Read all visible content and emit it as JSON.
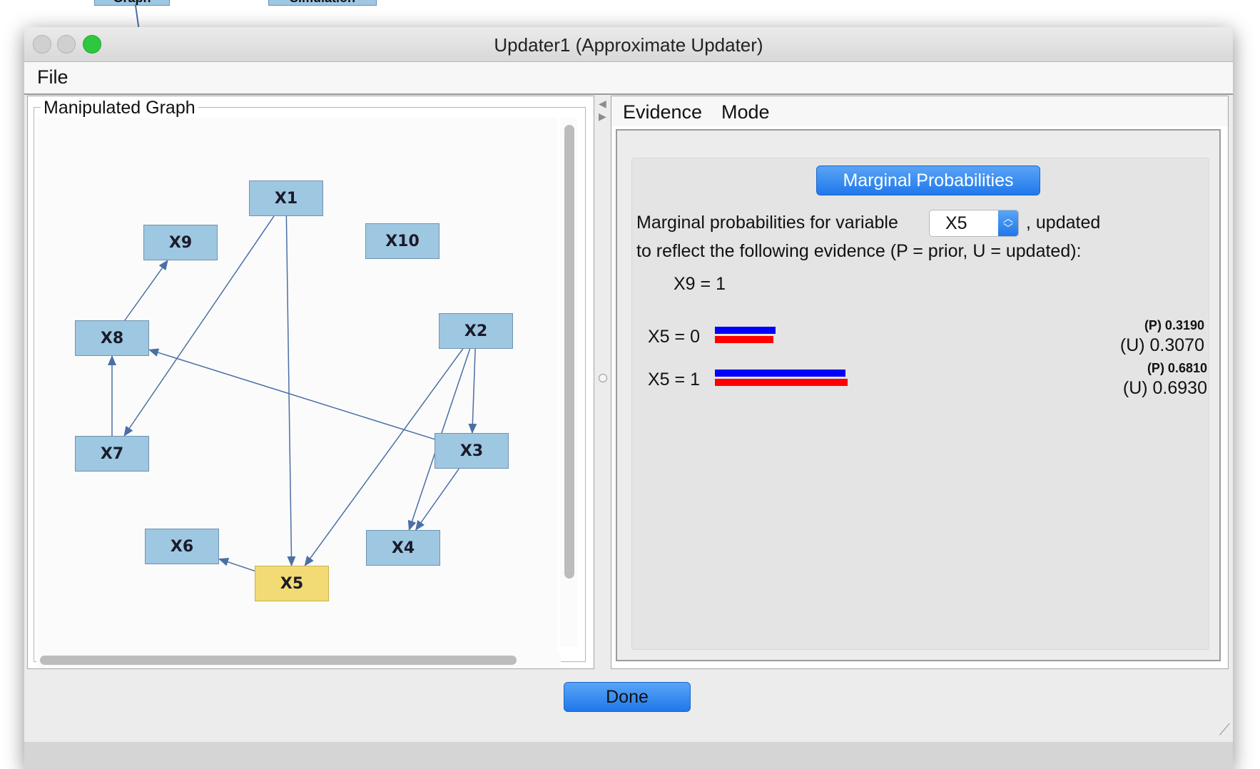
{
  "background": {
    "nodes": [
      "Graph",
      "Simulation"
    ]
  },
  "window": {
    "title": "Updater1 (Approximate Updater)",
    "menu": [
      "File"
    ]
  },
  "left_panel": {
    "title": "Manipulated Graph",
    "nodes": [
      {
        "id": "X1",
        "label": "X1",
        "selected": false
      },
      {
        "id": "X9",
        "label": "X9",
        "selected": false
      },
      {
        "id": "X10",
        "label": "X10",
        "selected": false
      },
      {
        "id": "X8",
        "label": "X8",
        "selected": false
      },
      {
        "id": "X2",
        "label": "X2",
        "selected": false
      },
      {
        "id": "X7",
        "label": "X7",
        "selected": false
      },
      {
        "id": "X3",
        "label": "X3",
        "selected": false
      },
      {
        "id": "X6",
        "label": "X6",
        "selected": false
      },
      {
        "id": "X5",
        "label": "X5",
        "selected": true
      },
      {
        "id": "X4",
        "label": "X4",
        "selected": false
      }
    ],
    "edges": [
      {
        "from": "X1",
        "to": "X7"
      },
      {
        "from": "X1",
        "to": "X5"
      },
      {
        "from": "X8",
        "to": "X9"
      },
      {
        "from": "X7",
        "to": "X8"
      },
      {
        "from": "X3",
        "to": "X8"
      },
      {
        "from": "X2",
        "to": "X3"
      },
      {
        "from": "X2",
        "to": "X5"
      },
      {
        "from": "X2",
        "to": "X4"
      },
      {
        "from": "X3",
        "to": "X4"
      },
      {
        "from": "X5",
        "to": "X6"
      }
    ]
  },
  "right_panel": {
    "menu": [
      "Evidence",
      "Mode"
    ],
    "tab_label": "Marginal Probabilities",
    "line1_prefix": "Marginal probabilities for variable",
    "selected_variable": "X5",
    "line1_suffix": ", updated",
    "line2": "to reflect the following evidence (P = prior, U = updated):",
    "evidence": "X9 = 1",
    "rows": [
      {
        "label": "X5 = 0",
        "prior_text": "(P) 0.3190",
        "updated_text": "(U) 0.3070",
        "prior": 0.319,
        "updated": 0.307
      },
      {
        "label": "X5 = 1",
        "prior_text": "(P) 0.6810",
        "updated_text": "(U) 0.6930",
        "prior": 0.681,
        "updated": 0.693
      }
    ],
    "colors": {
      "prior": "#0000ff",
      "updated": "#ff0000"
    }
  },
  "footer": {
    "done_label": "Done"
  }
}
